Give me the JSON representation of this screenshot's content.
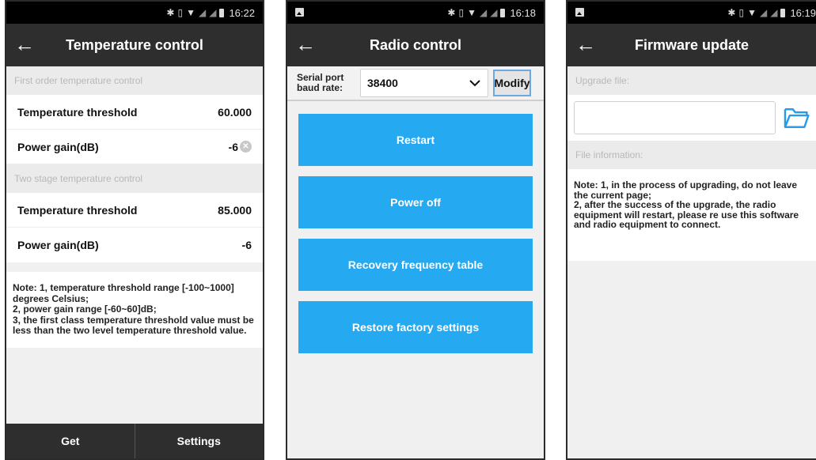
{
  "colors": {
    "title_bar": "#2e2e2e",
    "action_blue": "#25aaf2",
    "status_bar": "#000000",
    "section_bg": "#ebebeb"
  },
  "phone1": {
    "status_time": "16:22",
    "title": "Temperature control",
    "section1_header": "First order temperature control",
    "section1_rows": [
      {
        "label": "Temperature threshold",
        "value": "60.000"
      },
      {
        "label": "Power gain(dB)",
        "value": "-6"
      }
    ],
    "section2_header": "Two stage temperature control",
    "section2_rows": [
      {
        "label": "Temperature threshold",
        "value": "85.000"
      },
      {
        "label": "Power gain(dB)",
        "value": "-6"
      }
    ],
    "note": "Note: 1, temperature threshold range [-100~1000] degrees Celsius;\n 2, power gain range [-60~60]dB;\n 3, the first class temperature threshold value must be less than the two level temperature threshold value.",
    "get_label": "Get",
    "settings_label": "Settings"
  },
  "phone2": {
    "status_time": "16:18",
    "title": "Radio control",
    "baud_label": "Serial port\nbaud rate:",
    "baud_value": "38400",
    "modify_label": "Modify",
    "actions": [
      "Restart",
      "Power off",
      "Recovery frequency table",
      "Restore factory settings"
    ]
  },
  "phone3": {
    "status_time": "16:19",
    "title": "Firmware update",
    "upgrade_file_label": "Upgrade file:",
    "upgrade_file_value": "",
    "file_info_label": "File information:",
    "note": "Note: 1, in the process of upgrading, do not leave the current page;\n 2, after the success of the upgrade, the radio equipment will restart, please re use this software and radio equipment to connect."
  }
}
